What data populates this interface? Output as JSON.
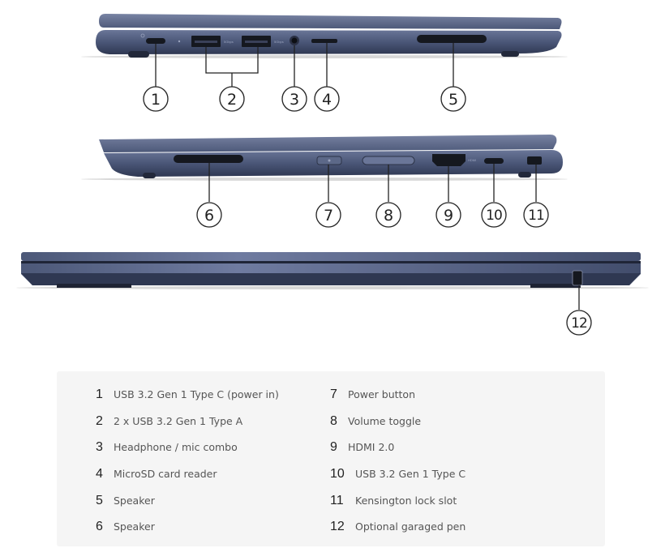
{
  "colors": {
    "chassis": "#4a5677",
    "chassis_light": "#6a7799",
    "chassis_dark": "#2f3852",
    "port_dark": "#15181f",
    "legend_bg": "#f5f5f5",
    "legend_number": "#222222",
    "legend_text": "#555555"
  },
  "views": [
    {
      "name": "left-side-view",
      "callouts": [
        "1",
        "2",
        "3",
        "4",
        "5"
      ]
    },
    {
      "name": "right-side-view",
      "callouts": [
        "6",
        "7",
        "8",
        "9",
        "10",
        "11"
      ]
    },
    {
      "name": "front-view",
      "callouts": [
        "12"
      ]
    }
  ],
  "port_markings": {
    "usb_a_speed": "5Gbps",
    "hdmi": "HDMI"
  },
  "legend": {
    "left": [
      {
        "num": "1",
        "label": "USB 3.2 Gen 1 Type C (power in)"
      },
      {
        "num": "2",
        "label": "2 x USB 3.2 Gen 1 Type A"
      },
      {
        "num": "3",
        "label": "Headphone / mic combo"
      },
      {
        "num": "4",
        "label": "MicroSD card reader"
      },
      {
        "num": "5",
        "label": "Speaker"
      },
      {
        "num": "6",
        "label": "Speaker"
      }
    ],
    "right": [
      {
        "num": "7",
        "label": "Power button"
      },
      {
        "num": "8",
        "label": "Volume toggle"
      },
      {
        "num": "9",
        "label": "HDMI 2.0"
      },
      {
        "num": "10",
        "label": "USB 3.2 Gen 1 Type C"
      },
      {
        "num": "11",
        "label": "Kensington lock slot"
      },
      {
        "num": "12",
        "label": "Optional garaged pen"
      }
    ]
  }
}
